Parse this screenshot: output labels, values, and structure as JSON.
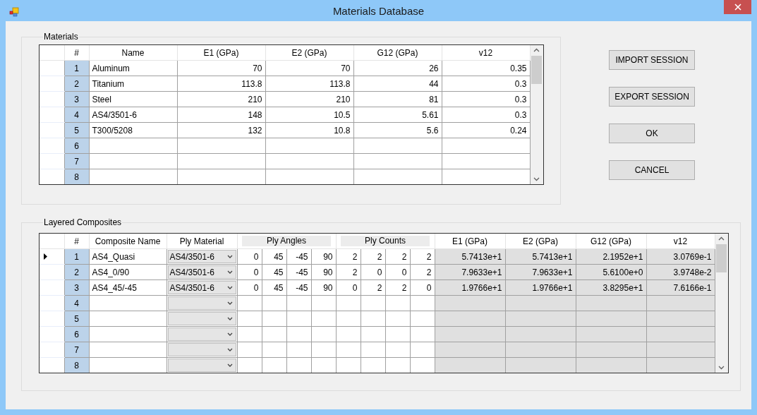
{
  "window": {
    "title": "Materials Database"
  },
  "materials": {
    "label": "Materials",
    "columns": [
      "#",
      "Name",
      "E1 (GPa)",
      "E2 (GPa)",
      "G12 (GPa)",
      "v12"
    ],
    "rows": [
      {
        "cells": [
          "1",
          "Aluminum",
          "70",
          "70",
          "26",
          "0.35"
        ]
      },
      {
        "cells": [
          "2",
          "Titanium",
          "113.8",
          "113.8",
          "44",
          "0.3"
        ]
      },
      {
        "cells": [
          "3",
          "Steel",
          "210",
          "210",
          "81",
          "0.3"
        ]
      },
      {
        "cells": [
          "4",
          "AS4/3501-6",
          "148",
          "10.5",
          "5.61",
          "0.3"
        ]
      },
      {
        "cells": [
          "5",
          "T300/5208",
          "132",
          "10.8",
          "5.6",
          "0.24"
        ]
      },
      {
        "cells": [
          "6"
        ]
      },
      {
        "cells": [
          "7"
        ]
      },
      {
        "cells": [
          "8"
        ]
      }
    ]
  },
  "buttons": [
    "IMPORT SESSION",
    "EXPORT SESSION",
    "OK",
    "CANCEL"
  ],
  "composites": {
    "label": "Layered Composites",
    "columns": {
      "number": "#",
      "name": "Composite Name",
      "ply_material": "Ply Material",
      "ply_angles": "Ply Angles",
      "ply_counts": "Ply Counts",
      "e1": "E1 (GPa)",
      "e2": "E2 (GPa)",
      "g12": "G12 (GPa)",
      "v12": "v12"
    },
    "rows": [
      {
        "number": "1",
        "current": true,
        "name": "AS4_Quasi",
        "ply_material": "AS4/3501-6",
        "ply_angles": [
          "0",
          "45",
          "-45",
          "90"
        ],
        "ply_counts": [
          "2",
          "2",
          "2",
          "2"
        ],
        "e1": "5.7413e+1",
        "e2": "5.7413e+1",
        "g12": "2.1952e+1",
        "v12": "3.0769e-1"
      },
      {
        "number": "2",
        "current": false,
        "name": "AS4_0/90",
        "ply_material": "AS4/3501-6",
        "ply_angles": [
          "0",
          "45",
          "-45",
          "90"
        ],
        "ply_counts": [
          "2",
          "0",
          "0",
          "2"
        ],
        "e1": "7.9633e+1",
        "e2": "7.9633e+1",
        "g12": "5.6100e+0",
        "v12": "3.9748e-2"
      },
      {
        "number": "3",
        "current": false,
        "name": "AS4_45/-45",
        "ply_material": "AS4/3501-6",
        "ply_angles": [
          "0",
          "45",
          "-45",
          "90"
        ],
        "ply_counts": [
          "0",
          "2",
          "2",
          "0"
        ],
        "e1": "1.9766e+1",
        "e2": "1.9766e+1",
        "g12": "3.8295e+1",
        "v12": "7.6166e-1"
      },
      {
        "number": "4",
        "current": false
      },
      {
        "number": "5",
        "current": false
      },
      {
        "number": "6",
        "current": false
      },
      {
        "number": "7",
        "current": false
      },
      {
        "number": "8",
        "current": false
      }
    ]
  }
}
